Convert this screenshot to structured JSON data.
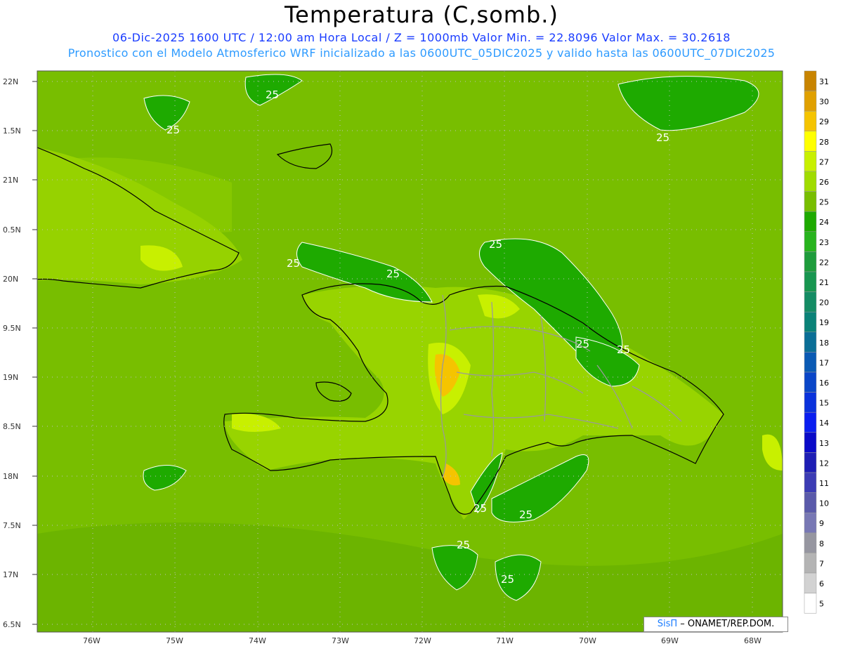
{
  "header": {
    "title": "Temperatura (C,somb.)",
    "subtitle1": "06-Dic-2025 1600 UTC / 12:00 am Hora Local / Z = 1000mb  Valor Min. = 22.8096  Valor Max. = 30.2618",
    "subtitle2": "Pronostico con el Modelo Atmosferico WRF inicializado a las 0600UTC_05DIC2025 y valido hasta las  0600UTC_07DIC2025"
  },
  "axes": {
    "lat_labels": [
      "22N",
      "1.5N",
      "21N",
      "0.5N",
      "20N",
      "9.5N",
      "19N",
      "8.5N",
      "18N",
      "7.5N",
      "17N",
      "6.5N"
    ],
    "lon_labels": [
      "76W",
      "75W",
      "74W",
      "73W",
      "72W",
      "71W",
      "70W",
      "69W",
      "68W"
    ]
  },
  "colorbar": {
    "labels": [
      "31",
      "30",
      "29",
      "28",
      "27",
      "26",
      "25",
      "24",
      "23",
      "22",
      "21",
      "20",
      "19",
      "18",
      "17",
      "16",
      "15",
      "14",
      "13",
      "12",
      "11",
      "10",
      "9",
      "8",
      "7",
      "6",
      "5"
    ],
    "colors": [
      "#c88400",
      "#e0a000",
      "#f5c400",
      "#ffff00",
      "#c8f000",
      "#a0dc00",
      "#78be00",
      "#1eaa00",
      "#28b41e",
      "#1e9c3c",
      "#189650",
      "#148c64",
      "#0a8278",
      "#0a6e96",
      "#0a5ab4",
      "#0a46c8",
      "#0a32dc",
      "#0a1ef0",
      "#0a0ac8",
      "#1e1eb4",
      "#3c3cb4",
      "#5a5aaa",
      "#7878b4",
      "#9696a0",
      "#b4b4b4",
      "#d2d2d2",
      "#ffffff"
    ]
  },
  "contour_label_value": "25",
  "credit": {
    "brand": "SisΠ",
    "text": "– ONAMET/REP.DOM."
  }
}
